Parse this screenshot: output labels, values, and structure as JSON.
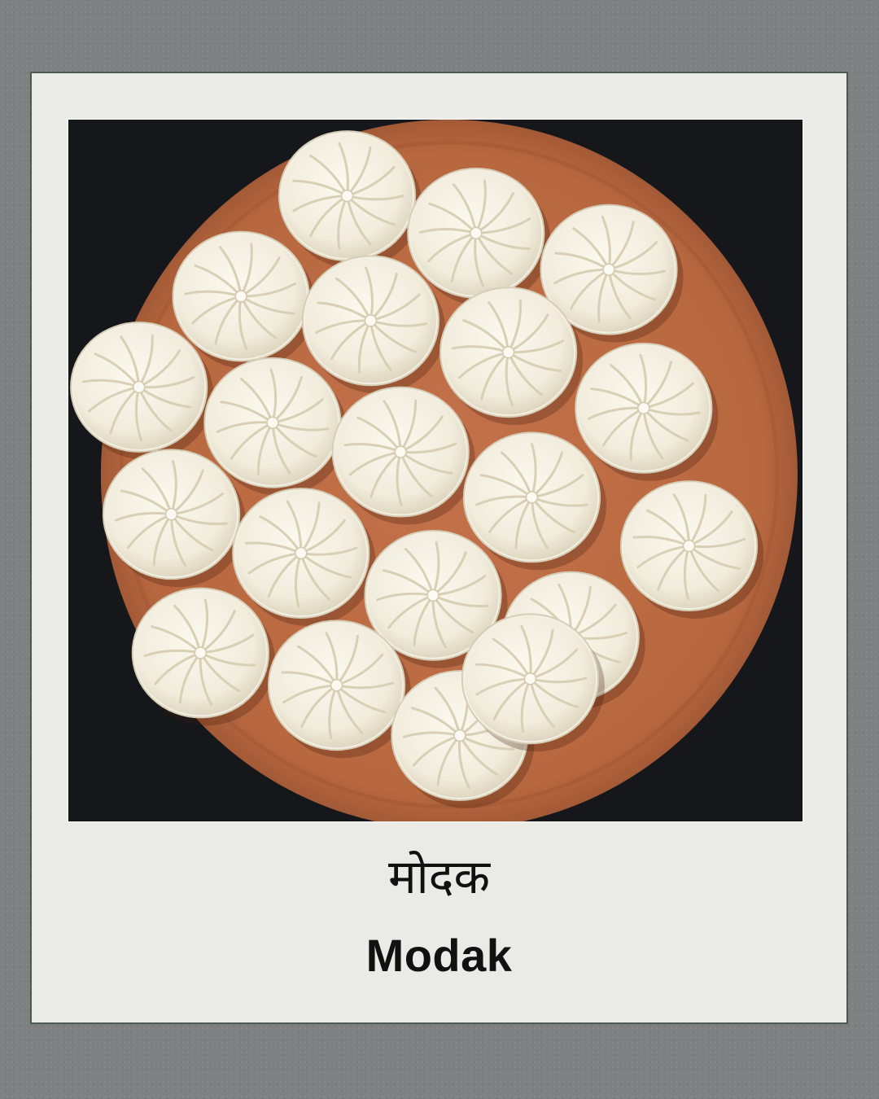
{
  "caption": {
    "hindi": "मोदक",
    "english": "Modak"
  },
  "photo": {
    "subject_icon": "modak-plate-illustration",
    "modak_count": 20
  },
  "colors": {
    "background": "#7f8081",
    "frame": "#eaeae6",
    "plate": "#b8683f",
    "modak": "#f3efe2",
    "text": "#111111"
  }
}
